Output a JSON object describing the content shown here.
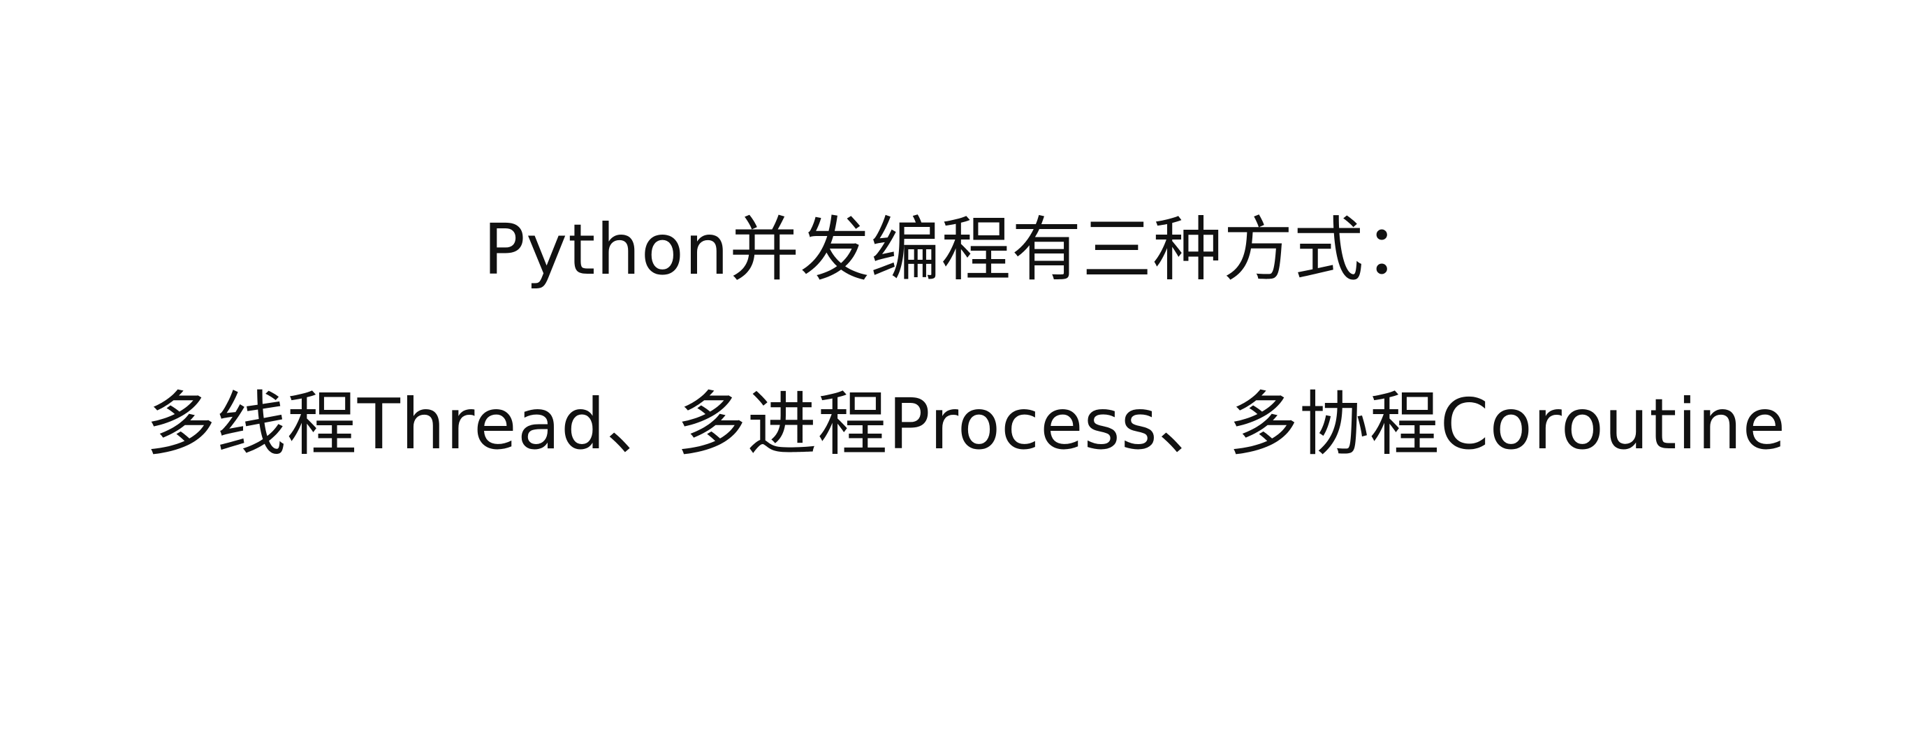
{
  "slide": {
    "title": "Python并发编程有三种方式：",
    "subtitle": "多线程Thread、多进程Process、多协程Coroutine"
  }
}
